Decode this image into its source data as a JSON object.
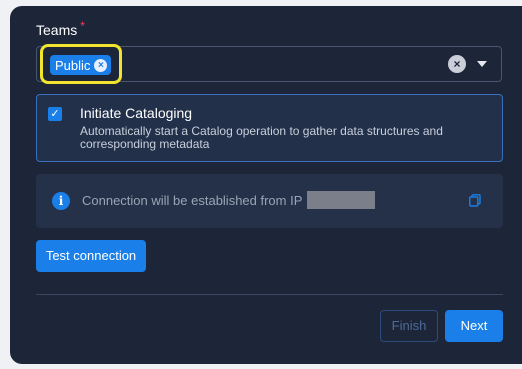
{
  "teams": {
    "label": "Teams",
    "required_mark": "*",
    "selected_chip": "Public",
    "chip_remove_icon": "close-circle-icon",
    "clear_icon": "clear-circle-icon",
    "dropdown_icon": "caret-down-icon"
  },
  "cataloging": {
    "checked": true,
    "title": "Initiate Cataloging",
    "description": "Automatically start a Catalog operation to gather data structures and corresponding metadata"
  },
  "connection": {
    "info_icon": "info-icon",
    "message": "Connection will be established from IP",
    "copy_icon": "copy-icon"
  },
  "buttons": {
    "test_connection": "Test connection",
    "finish": "Finish",
    "next": "Next"
  },
  "colors": {
    "panel_bg": "#1c2638",
    "accent": "#1a7fe8",
    "highlight": "#f0e52c",
    "required": "#ff3b5c"
  }
}
